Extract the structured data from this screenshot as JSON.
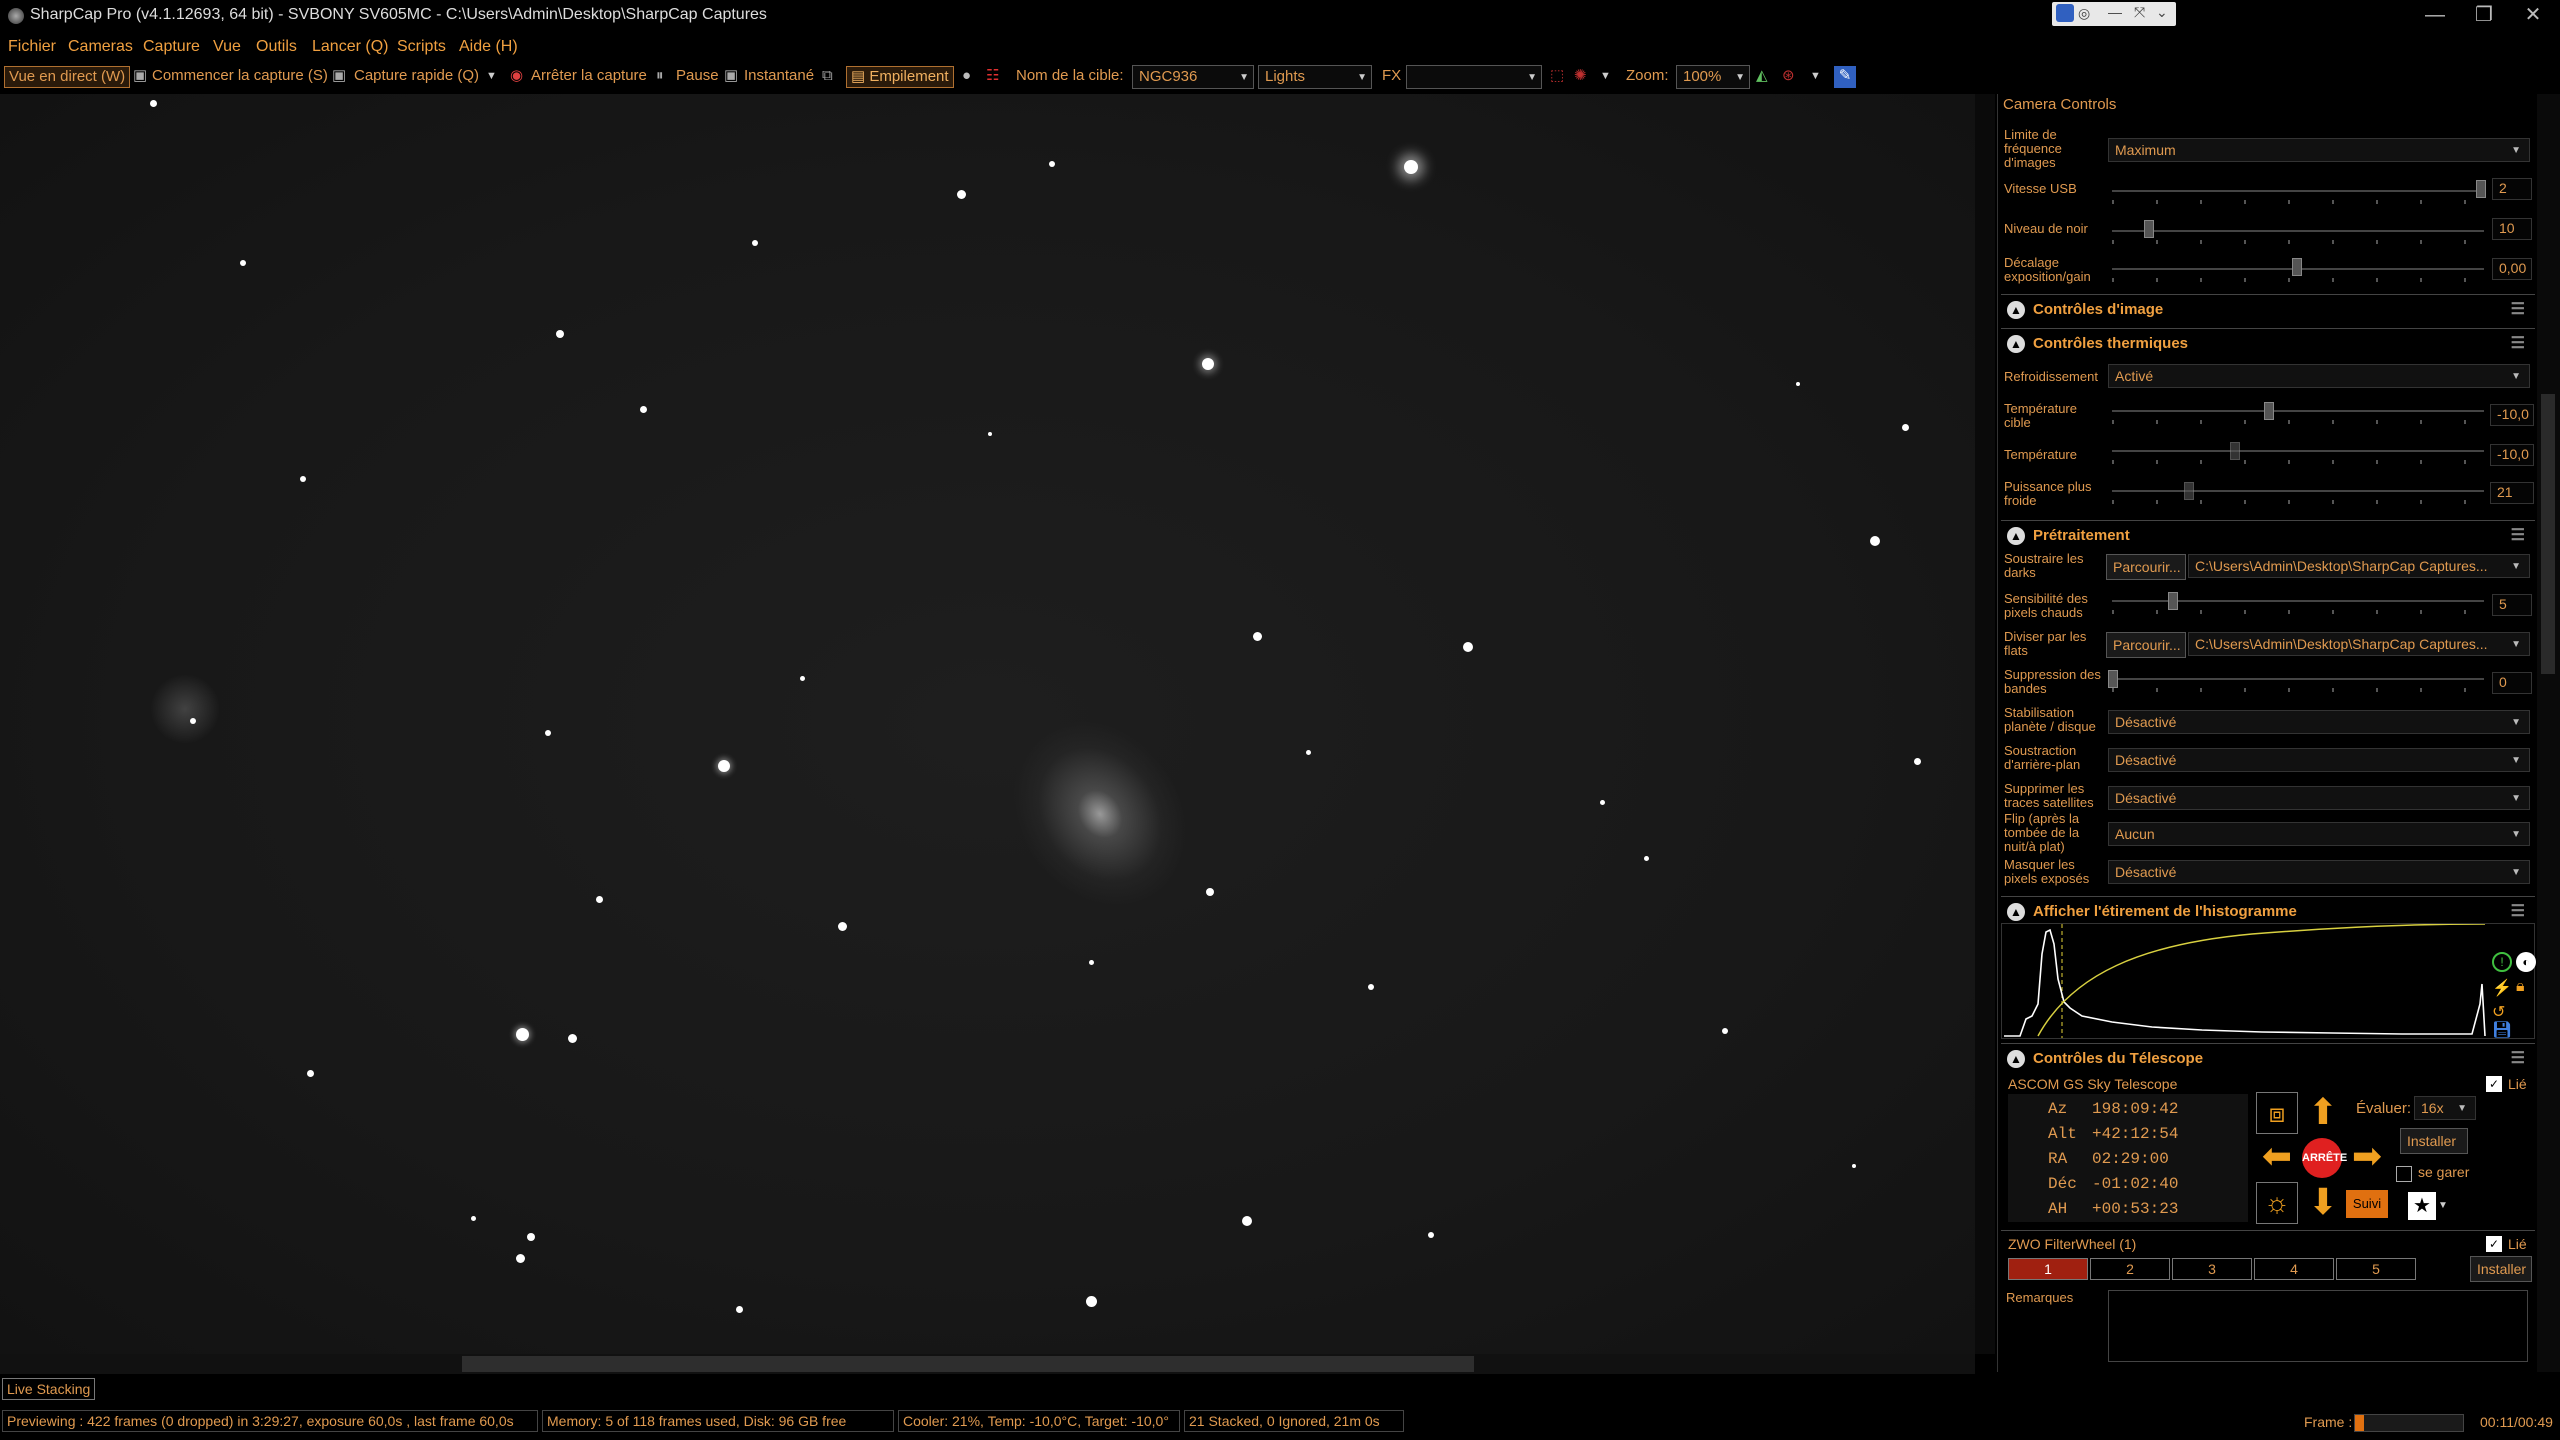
{
  "window": {
    "title": "SharpCap Pro (v4.1.12693, 64 bit) - SVBONY SV605MC - C:\\Users\\Admin\\Desktop\\SharpCap Captures",
    "controls": [
      "—",
      "❐",
      "✕"
    ]
  },
  "menu": [
    "Fichier",
    "Cameras",
    "Capture",
    "Vue",
    "Outils",
    "Lancer (Q)",
    "Scripts",
    "Aide (H)"
  ],
  "toolbar": {
    "live_view": "Vue en direct (W)",
    "start_capture": "Commencer la capture (S)",
    "quick_capture": "Capture rapide (Q)",
    "stop_capture": "Arrêter la capture",
    "pause": "Pause",
    "snapshot": "Instantané",
    "stacking": "Empilement",
    "target_label": "Nom de la cible:",
    "target_value": "NGC936",
    "frame_type": "Lights",
    "fx_label": "FX",
    "fx_value": "",
    "zoom_label": "Zoom:",
    "zoom_value": "100%"
  },
  "panel": {
    "title": "Camera Controls",
    "camera_rows": [
      {
        "label": "Limite de fréquence d'images",
        "type": "select",
        "value": "Maximum"
      },
      {
        "label": "Vitesse USB",
        "type": "slider",
        "value": "2",
        "level": 0.98
      },
      {
        "label": "Niveau de noir",
        "type": "slider",
        "value": "10",
        "level": 0.1
      },
      {
        "label": "Décalage exposition/gain",
        "type": "slider",
        "value": "0,00",
        "level": 0.5
      }
    ],
    "sections": {
      "image": "Contrôles d'image",
      "thermal": "Contrôles thermiques",
      "preprocess": "Prétraitement",
      "histogram": "Afficher l'étirement de l'histogramme",
      "telescope": "Contrôles du Télescope"
    },
    "thermal_rows": [
      {
        "label": "Refroidissement",
        "type": "select",
        "value": "Activé"
      },
      {
        "label": "Température cible",
        "type": "slider",
        "value": "-10,0",
        "level": 0.42
      },
      {
        "label": "Température",
        "type": "slider",
        "value": "-10,0",
        "level": 0.33
      },
      {
        "label": "Puissance plus froide",
        "type": "slider",
        "value": "21",
        "level": 0.21
      }
    ],
    "preprocess_rows": [
      {
        "label": "Soustraire les darks",
        "type": "file",
        "button": "Parcourir...",
        "value": "C:\\Users\\Admin\\Desktop\\SharpCap Captures..."
      },
      {
        "label": "Sensibilité des pixels chauds",
        "type": "slider",
        "value": "5",
        "level": 0.16
      },
      {
        "label": "Diviser par les flats",
        "type": "file",
        "button": "Parcourir...",
        "value": "C:\\Users\\Admin\\Desktop\\SharpCap Captures..."
      },
      {
        "label": "Suppression des bandes",
        "type": "slider",
        "value": "0",
        "level": 0.0
      },
      {
        "label": "Stabilisation planète / disque",
        "type": "select",
        "value": "Désactivé"
      },
      {
        "label": "Soustraction d'arrière-plan",
        "type": "select",
        "value": "Désactivé"
      },
      {
        "label": "Supprimer les traces satellites",
        "type": "select",
        "value": "Désactivé"
      },
      {
        "label": "Flip (après la tombée de la nuit/à plat)",
        "type": "select",
        "value": "Aucun"
      },
      {
        "label": "Masquer les pixels exposés",
        "type": "select",
        "value": "Désactivé"
      }
    ],
    "telescope": {
      "name": "ASCOM GS Sky Telescope",
      "linked_label": "Lié",
      "coords": [
        {
          "k": "Az",
          "v": "198:09:42"
        },
        {
          "k": "Alt",
          "v": "+42:12:54"
        },
        {
          "k": "RA",
          "v": "02:29:00"
        },
        {
          "k": "Déc",
          "v": "-01:02:40"
        },
        {
          "k": "AH",
          "v": "+00:53:23"
        }
      ],
      "stop_label": "ARRÊTE",
      "rate_label": "Évaluer:",
      "rate_value": "16x",
      "setup_button": "Installer",
      "park_label": "se garer",
      "track_label": "Suivi"
    },
    "filterwheel": {
      "name": "ZWO FilterWheel (1)",
      "linked_label": "Lié",
      "slots": [
        "1",
        "2",
        "3",
        "4",
        "5"
      ],
      "active": "1",
      "setup_button": "Installer"
    },
    "notes_label": "Remarques"
  },
  "live_stacking_tab": "Live Stacking",
  "status": {
    "preview": "Previewing : 422 frames (0 dropped) in 3:29:27, exposure 60,0s , last frame 60,0s",
    "memory": "Memory: 5 of 118 frames used, Disk: 96 GB free",
    "cooler": "Cooler: 21%, Temp: -10,0°C, Target: -10,0°",
    "stacked": "21 Stacked, 0 Ignored, 21m 0s",
    "frame_label": "Frame :",
    "frame_progress": 0.08,
    "time": "00:11/00:49"
  },
  "colors": {
    "accent": "#e09a50",
    "stop": "#e02020",
    "arrows": "#f0a020"
  }
}
